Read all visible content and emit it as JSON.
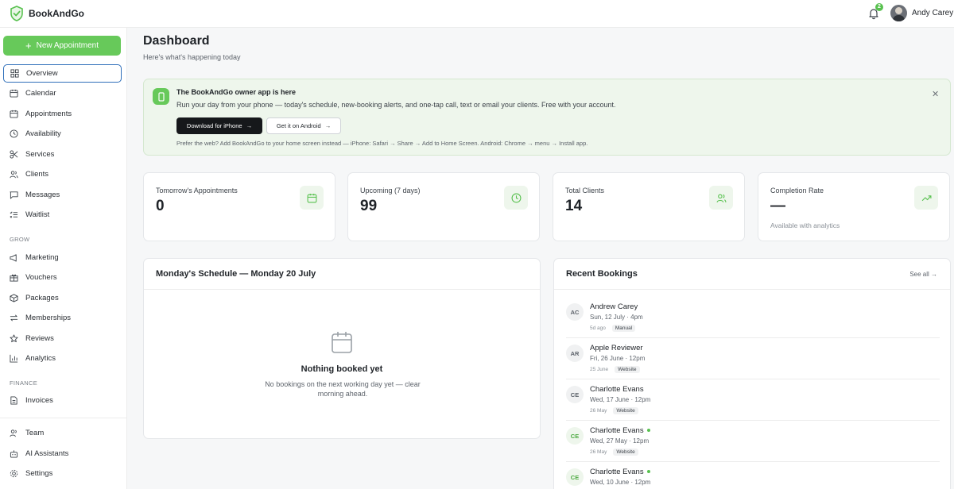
{
  "app": {
    "name": "BookAndGo",
    "notification_count": "2",
    "user_name": "Andy Carey"
  },
  "sidebar": {
    "new_button": "New Appointment",
    "items": [
      {
        "label": "Overview",
        "icon": "grid-icon"
      },
      {
        "label": "Calendar",
        "icon": "calendar-icon"
      },
      {
        "label": "Appointments",
        "icon": "calendar-check-icon"
      },
      {
        "label": "Availability",
        "icon": "clock-icon"
      },
      {
        "label": "Services",
        "icon": "scissors-icon"
      },
      {
        "label": "Clients",
        "icon": "users-icon"
      },
      {
        "label": "Messages",
        "icon": "message-icon"
      },
      {
        "label": "Waitlist",
        "icon": "list-icon"
      }
    ],
    "grow_label": "GROW",
    "grow_items": [
      {
        "label": "Marketing",
        "icon": "megaphone-icon"
      },
      {
        "label": "Vouchers",
        "icon": "gift-icon"
      },
      {
        "label": "Packages",
        "icon": "package-icon"
      },
      {
        "label": "Memberships",
        "icon": "repeat-icon"
      },
      {
        "label": "Reviews",
        "icon": "star-icon"
      },
      {
        "label": "Analytics",
        "icon": "bar-chart-icon"
      }
    ],
    "finance_label": "FINANCE",
    "finance_items": [
      {
        "label": "Invoices",
        "icon": "file-icon"
      }
    ],
    "bottom_items": [
      {
        "label": "Team",
        "icon": "team-icon"
      },
      {
        "label": "AI Assistants",
        "icon": "bot-icon"
      },
      {
        "label": "Settings",
        "icon": "gear-icon"
      }
    ]
  },
  "header": {
    "title": "Dashboard",
    "subtitle": "Here's what's happening today"
  },
  "banner": {
    "title": "The BookAndGo owner app is here",
    "text": "Run your day from your phone — today's schedule, new-booking alerts, and one-tap call, text or email your clients. Free with your account.",
    "iphone_button": "Download for iPhone",
    "android_button": "Get it on Android",
    "note": "Prefer the web? Add BookAndGo to your home screen instead — iPhone: Safari → Share → Add to Home Screen. Android: Chrome → menu → Install app."
  },
  "stats": [
    {
      "label": "Tomorrow's Appointments",
      "value": "0",
      "sub": "",
      "icon": "calendar-icon"
    },
    {
      "label": "Upcoming (7 days)",
      "value": "99",
      "sub": "",
      "icon": "clock-icon"
    },
    {
      "label": "Total Clients",
      "value": "14",
      "sub": "",
      "icon": "users-icon"
    },
    {
      "label": "Completion Rate",
      "value": "—",
      "sub": "Available with analytics",
      "icon": "trend-up-icon"
    }
  ],
  "schedule": {
    "title": "Monday's Schedule — Monday 20 July",
    "empty_title": "Nothing booked yet",
    "empty_text": "No bookings on the next working day yet — clear morning ahead."
  },
  "bookings": {
    "title": "Recent Bookings",
    "see_all": "See all →",
    "items": [
      {
        "initials": "AC",
        "name": "Andrew Carey",
        "time": "Sun, 12 July · 4pm",
        "ago": "5d ago",
        "source": "Manual",
        "new": false
      },
      {
        "initials": "AR",
        "name": "Apple Reviewer",
        "time": "Fri, 26 June · 12pm",
        "ago": "25 June",
        "source": "Website",
        "new": false
      },
      {
        "initials": "CE",
        "name": "Charlotte Evans",
        "time": "Wed, 17 June · 12pm",
        "ago": "26 May",
        "source": "Website",
        "new": false
      },
      {
        "initials": "CE",
        "name": "Charlotte Evans",
        "time": "Wed, 27 May · 12pm",
        "ago": "26 May",
        "source": "Website",
        "new": true
      },
      {
        "initials": "CE",
        "name": "Charlotte Evans",
        "time": "Wed, 10 June · 12pm",
        "ago": "",
        "source": "",
        "new": true
      }
    ]
  },
  "colors": {
    "accent": "#67c95a",
    "active_border": "#2f6fba",
    "banner_bg": "#eef6ec"
  }
}
